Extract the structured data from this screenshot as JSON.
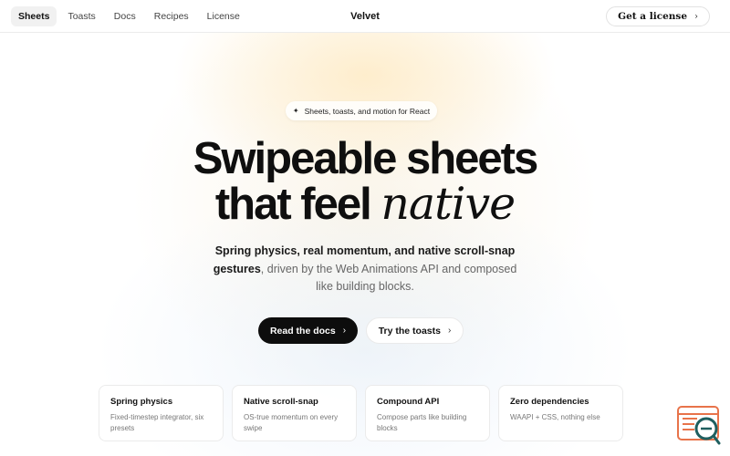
{
  "nav": {
    "links": [
      {
        "label": "Sheets",
        "active": true
      },
      {
        "label": "Toasts"
      },
      {
        "label": "Docs"
      },
      {
        "label": "Recipes"
      },
      {
        "label": "License"
      }
    ],
    "brand": "Velvet",
    "cta_label": "Get a license",
    "cta_icon": "chevron-right-icon"
  },
  "hero": {
    "pill_icon": "sparkle-icon",
    "pill_text": "Sheets, toasts, and motion for React",
    "headline_line1": "Swipeable sheets",
    "headline_line2_a": "that feel",
    "headline_line2_b": "native",
    "sub_bold": "Spring physics, real momentum, and native scroll-snap gestures",
    "sub_rest": ", driven by the Web Animations API and composed like building blocks.",
    "primary_button": "Read the docs",
    "secondary_button": "Try the toasts"
  },
  "features": [
    {
      "title": "Spring physics",
      "desc": "Fixed-timestep integrator, six presets"
    },
    {
      "title": "Native scroll-snap",
      "desc": "OS-true momentum on every swipe"
    },
    {
      "title": "Compound API",
      "desc": "Compose parts like building blocks"
    },
    {
      "title": "Zero dependencies",
      "desc": "WAAPI + CSS, nothing else"
    }
  ],
  "chat_widget": {
    "icon": "chat-support-icon",
    "accent": "#e8734a",
    "accent2": "#1f5f5f"
  }
}
